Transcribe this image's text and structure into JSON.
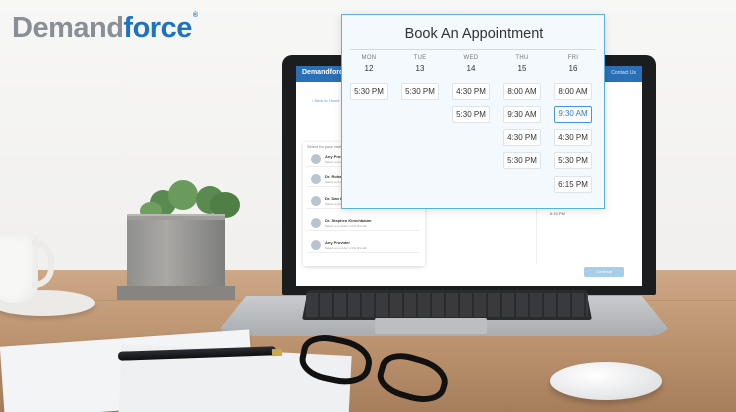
{
  "brand": {
    "part1": "Demand",
    "part2": "force",
    "reg": "®"
  },
  "screen": {
    "brand": "Demandforce",
    "contact": "Contact Us",
    "back_link": "‹ Back to Home",
    "panel_title": "Select for your visit",
    "providers": [
      {
        "name": "Any Provider",
        "sub": "Select a provider"
      },
      {
        "name": "Dr. Rohan",
        "sub": "Select a provider in this first tab"
      },
      {
        "name": "Dr. Dan Hein",
        "sub": "Select a provider in this first tab"
      },
      {
        "name": "Dr. Stephen Kirschbaum",
        "sub": "Select a provider in this first tab"
      },
      {
        "name": "Any Provider",
        "sub": "Select a provider in this first tab"
      }
    ],
    "time_label": "6:15 PM",
    "continue": "Continue"
  },
  "dialog": {
    "title": "Book An Appointment",
    "days": [
      {
        "dow": "MON",
        "date": "12",
        "slots": [
          "5:30 PM"
        ]
      },
      {
        "dow": "TUE",
        "date": "13",
        "slots": [
          "5:30 PM"
        ]
      },
      {
        "dow": "WED",
        "date": "14",
        "slots": [
          "4:30 PM",
          "5:30 PM"
        ]
      },
      {
        "dow": "THU",
        "date": "15",
        "slots": [
          "8:00 AM",
          "9:30 AM",
          "4:30 PM",
          "5:30 PM"
        ]
      },
      {
        "dow": "FRI",
        "date": "16",
        "slots": [
          "8:00 AM",
          "9:30 AM",
          "4:30 PM",
          "5:30 PM",
          "6:15 PM"
        ]
      }
    ],
    "selected": {
      "day": "FRI",
      "slot": "9:30 AM"
    },
    "accent_color": "#3f9bd7"
  }
}
